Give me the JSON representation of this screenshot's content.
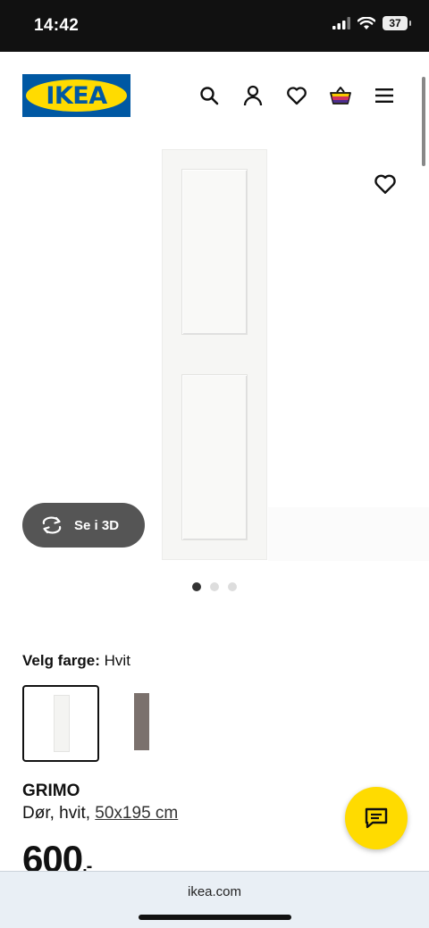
{
  "status_bar": {
    "time": "14:42",
    "battery": "37"
  },
  "header": {
    "logo": "IKEA",
    "icons": [
      "search-icon",
      "user-icon",
      "heart-icon",
      "basket-icon",
      "menu-icon"
    ]
  },
  "gallery": {
    "view_3d_label": "Se i 3D",
    "dots_count": 3,
    "active_dot": 0
  },
  "color_picker": {
    "label": "Velg farge:",
    "selected": "Hvit"
  },
  "product": {
    "name": "GRIMO",
    "description": "Dør, hvit,",
    "measure": "50x195 cm",
    "price": "600",
    "price_suffix": ",-"
  },
  "browser": {
    "url": "ikea.com"
  },
  "colors": {
    "ikea_blue": "#0058a3",
    "ikea_yellow": "#ffdb00"
  }
}
